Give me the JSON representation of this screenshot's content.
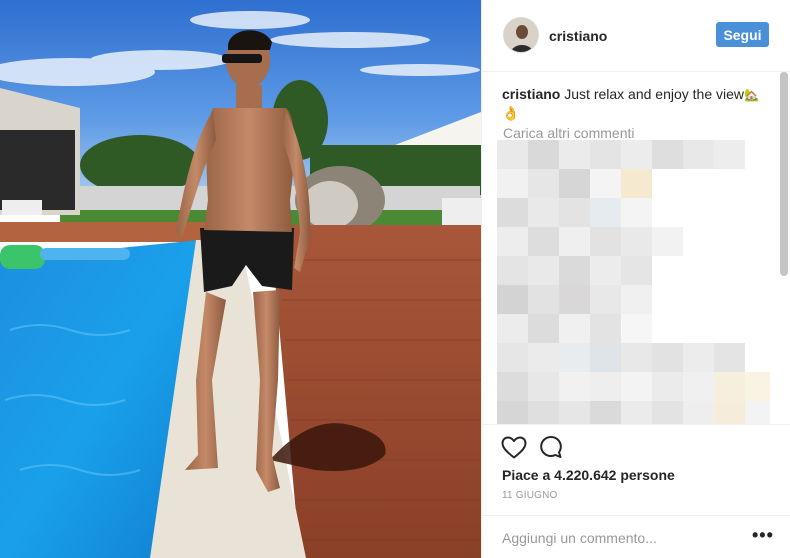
{
  "post": {
    "username": "cristiano",
    "follow_label": "Segui",
    "caption_user": "cristiano",
    "caption_text": "Just relax and enjoy the view",
    "caption_emoji_1": "🏡",
    "caption_emoji_2": "👌",
    "load_more_label": "Carica altri commenti",
    "likes_text": "Piace a 4.220.642 persone",
    "date_text": "11 GIUGNO",
    "comment_placeholder": "Aggiungi un commento...",
    "more_label": "•••"
  },
  "icons": {
    "like": "heart-icon",
    "comment": "comment-icon",
    "more": "more-options-icon"
  },
  "colors": {
    "follow_button": "#4a90d9",
    "muted_text": "#999999",
    "divider": "#efefef"
  }
}
